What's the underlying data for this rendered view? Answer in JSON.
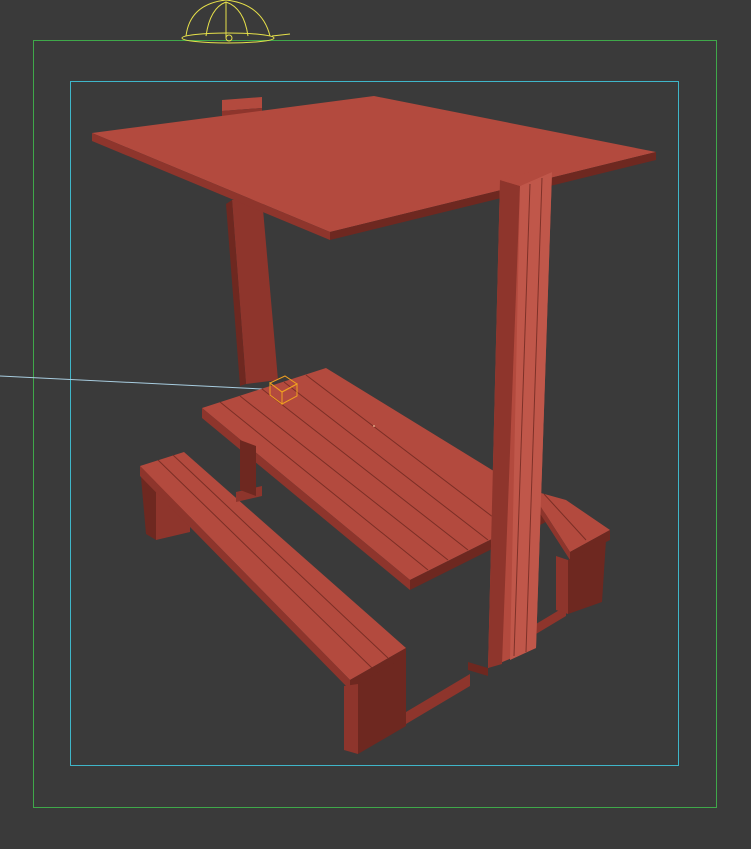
{
  "viewport": {
    "background": "#3a3a3a",
    "render_frame_color": "#3fa84a",
    "safe_frame_color": "#3fb6c9"
  },
  "scene": {
    "model_color": "#b34a3e",
    "model_dark": "#8e352c",
    "model_darker": "#6e2820",
    "model_light": "#c0574a",
    "light_gizmo_color": "#e6e04a",
    "target_gizmo_color": "#f0a020",
    "target_line_color": "#a8cde0"
  },
  "icons": {
    "light": "omni-light-icon",
    "target": "light-target-icon"
  }
}
